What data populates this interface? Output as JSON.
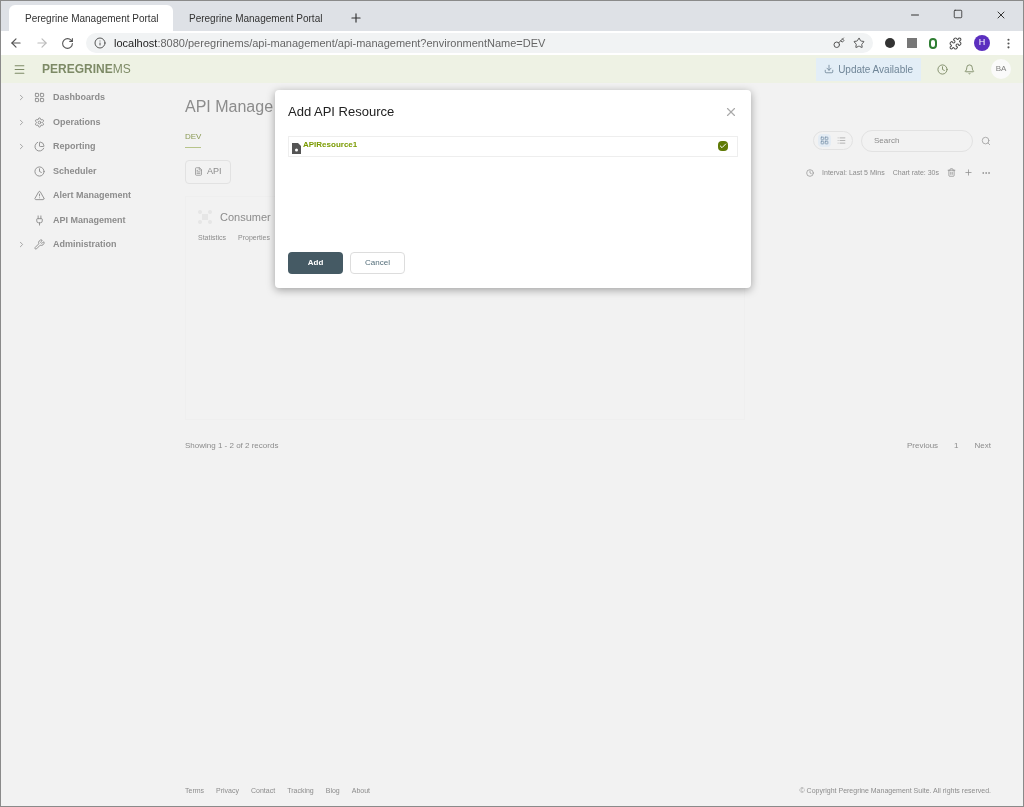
{
  "browser": {
    "tabs": [
      {
        "title": "Peregrine Management Portal",
        "selected": true
      },
      {
        "title": "Peregrine Management Portal",
        "selected": false
      }
    ],
    "url_host": "localhost",
    "url_rest": ":8080/peregrinems/api-management/api-management?environmentName=DEV",
    "profile": "H"
  },
  "app_header": {
    "brand": "PEREGRINE",
    "brand_suffix": "MS",
    "update_button": "Update Available",
    "avatar": "BA"
  },
  "sidebar": {
    "items": [
      {
        "label": "Dashboards",
        "kind": "grid",
        "expandable": true
      },
      {
        "label": "Operations",
        "kind": "gear",
        "expandable": true
      },
      {
        "label": "Reporting",
        "kind": "chart",
        "expandable": true
      },
      {
        "label": "Scheduler",
        "kind": "clock",
        "expandable": false
      },
      {
        "label": "Alert Management",
        "kind": "alert",
        "expandable": false
      },
      {
        "label": "API Management",
        "kind": "plug",
        "expandable": false
      },
      {
        "label": "Administration",
        "kind": "wrench",
        "expandable": true
      }
    ]
  },
  "page": {
    "title": "API Manage",
    "tabs": [
      {
        "label": "DEV",
        "selected": true
      }
    ],
    "api_button": "API",
    "card_title": "Consumer",
    "view_modes": [
      {
        "kind": "grid",
        "selected": true
      },
      {
        "kind": "list",
        "selected": false
      }
    ],
    "card_tabs": [
      "Statistics",
      "Properties"
    ],
    "search_placeholder": "Search",
    "interval": "Interval: Last 5 Mins",
    "chart_rate": "Chart rate: 30s",
    "records": "Showing 1 - 2 of 2 records",
    "pagination": {
      "previous": "Previous",
      "page": "1",
      "next": "Next"
    }
  },
  "footer": {
    "links": [
      "Terms",
      "Privacy",
      "Contact",
      "Tracking",
      "Blog",
      "About"
    ],
    "copyright": "© Copyright Peregrine Management Suite. All rights reserved."
  },
  "dialog": {
    "title": "Add API Resource",
    "resources": [
      {
        "name": "APIResource1",
        "checked": true
      }
    ],
    "buttons": [
      {
        "label": "Add",
        "kind": "primary"
      },
      {
        "label": "Cancel",
        "kind": "secondary"
      }
    ]
  }
}
